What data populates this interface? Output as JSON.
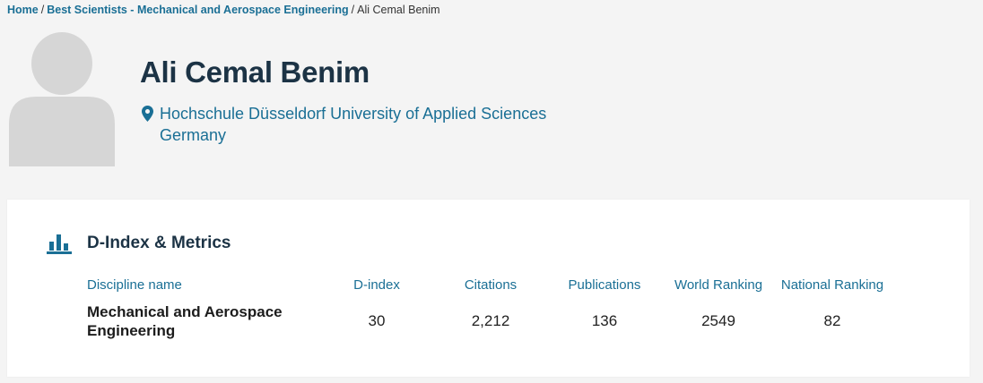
{
  "breadcrumb": {
    "home": "Home",
    "category": "Best Scientists - Mechanical and Aerospace Engineering",
    "current": "Ali Cemal Benim"
  },
  "profile": {
    "name": "Ali Cemal Benim",
    "institution": "Hochschule Düsseldorf University of Applied Sciences",
    "country": "Germany"
  },
  "metrics": {
    "title": "D-Index & Metrics",
    "headers": [
      "Discipline name",
      "D-index",
      "Citations",
      "Publications",
      "World Ranking",
      "National Ranking"
    ],
    "rows": [
      {
        "discipline": "Mechanical and Aerospace Engineering",
        "d_index": "30",
        "citations": "2,212",
        "publications": "136",
        "world_ranking": "2549",
        "national_ranking": "82"
      }
    ]
  },
  "colors": {
    "link": "#1a6f95",
    "heading": "#1c3345",
    "background": "#f4f4f4",
    "card": "#ffffff"
  },
  "icons": [
    "avatar-placeholder",
    "map-pin-icon",
    "bar-chart-icon"
  ]
}
